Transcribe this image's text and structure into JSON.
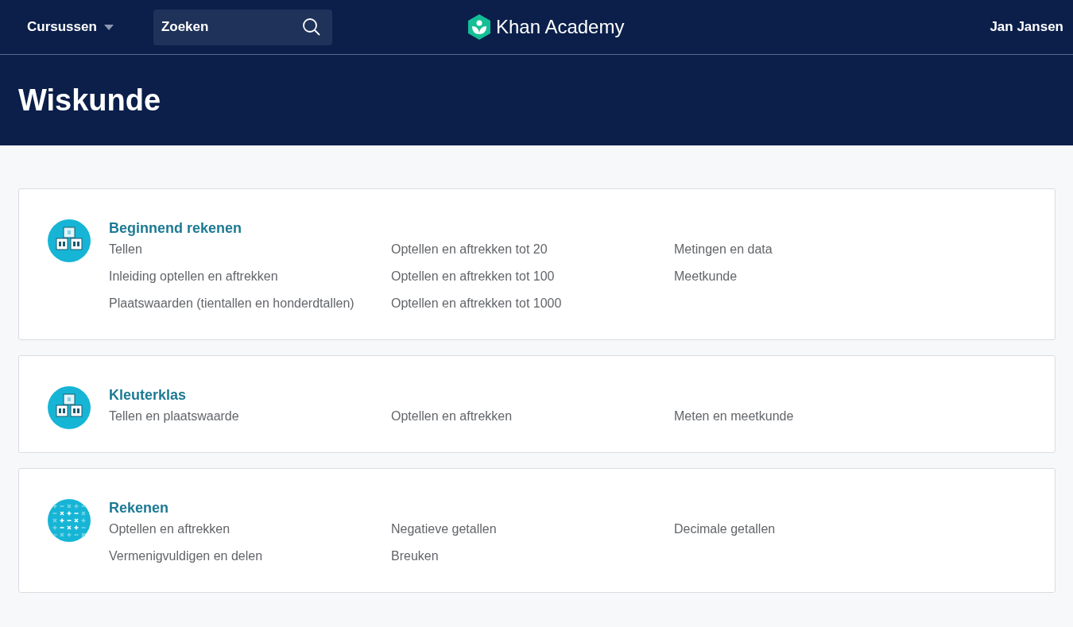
{
  "nav": {
    "courses_menu": "Cursussen",
    "search": {
      "placeholder": "Zoeken"
    },
    "logo_text": "Khan Academy",
    "user": "Jan Jansen"
  },
  "page_title": "Wiskunde",
  "courses": [
    {
      "title": "Beginnend rekenen",
      "icon": {
        "kind": "blocks"
      },
      "columns": [
        [
          "Tellen",
          "Inleiding optellen en aftrekken",
          "Plaatswaarden (tientallen en honderdtallen)"
        ],
        [
          "Optellen en aftrekken tot 20",
          "Optellen en aftrekken tot 100",
          "Optellen en aftrekken tot 1000"
        ],
        [
          "Metingen en data",
          "Meetkunde"
        ]
      ]
    },
    {
      "title": "Kleuterklas",
      "icon": {
        "kind": "blocks"
      },
      "columns": [
        [
          "Tellen en plaatswaarde"
        ],
        [
          "Optellen en aftrekken"
        ],
        [
          "Meten en meetkunde"
        ]
      ]
    },
    {
      "title": "Rekenen",
      "icon": {
        "kind": "symbols"
      },
      "columns": [
        [
          "Optellen en aftrekken",
          "Vermenigvuldigen en delen"
        ],
        [
          "Negatieve getallen",
          "Breuken"
        ],
        [
          "Decimale getallen"
        ]
      ]
    }
  ]
}
